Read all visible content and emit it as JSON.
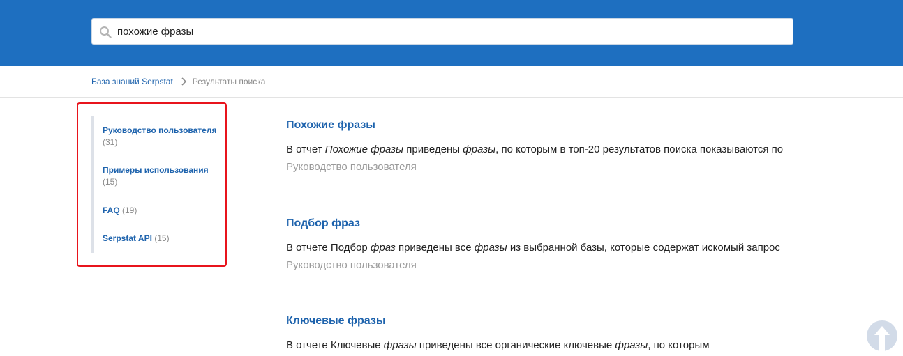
{
  "search": {
    "value": "похожие фразы",
    "icon": "search-icon"
  },
  "breadcrumb": {
    "home": "База знаний Serpstat",
    "current": "Результаты поиска"
  },
  "sidebar": {
    "items": [
      {
        "label": "Руководство пользователя",
        "count": "(31)"
      },
      {
        "label": "Примеры использования",
        "count": "(15)"
      },
      {
        "label": "FAQ",
        "count": "(19)"
      },
      {
        "label": "Serpstat API",
        "count": "(15)"
      }
    ]
  },
  "results": [
    {
      "title": "Похожие фразы",
      "snippet": [
        {
          "t": "В отчет ",
          "i": false
        },
        {
          "t": "Похожие фразы",
          "i": true
        },
        {
          "t": " приведены ",
          "i": false
        },
        {
          "t": "фразы",
          "i": true
        },
        {
          "t": ", по которым в топ-20 результатов поиска показываются по",
          "i": false
        }
      ],
      "category": "Руководство пользователя"
    },
    {
      "title": "Подбор фраз",
      "snippet": [
        {
          "t": "В отчете Подбор ",
          "i": false
        },
        {
          "t": "фраз",
          "i": true
        },
        {
          "t": " приведены все ",
          "i": false
        },
        {
          "t": "фразы",
          "i": true
        },
        {
          "t": " из выбранной базы, которые содержат искомый запрос",
          "i": false
        }
      ],
      "category": "Руководство пользователя"
    },
    {
      "title": "Ключевые фразы",
      "snippet": [
        {
          "t": "В отчете Ключевые ",
          "i": false
        },
        {
          "t": "фразы",
          "i": true
        },
        {
          "t": " приведены все органические ключевые ",
          "i": false
        },
        {
          "t": "фразы",
          "i": true
        },
        {
          "t": ", по которым",
          "i": false
        }
      ],
      "category": ""
    }
  ],
  "colors": {
    "header": "#1e6fc0",
    "link": "#1e63ad",
    "highlight_border": "#e8141c"
  }
}
